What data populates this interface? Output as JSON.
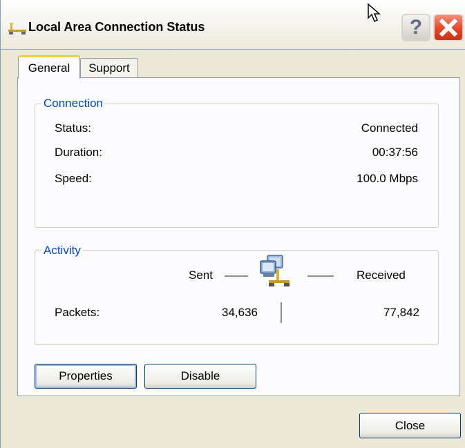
{
  "window": {
    "title": "Local Area Connection Status",
    "help_label": "?",
    "colors": {
      "title_close_red": "#e24727",
      "group_title_blue": "#0046d5",
      "tab_highlight": "#ffc83c"
    }
  },
  "tabs": [
    {
      "label": "General",
      "selected": true
    },
    {
      "label": "Support",
      "selected": false
    }
  ],
  "connection": {
    "title": "Connection",
    "rows": [
      {
        "label": "Status:",
        "value": "Connected"
      },
      {
        "label": "Duration:",
        "value": "00:37:56"
      },
      {
        "label": "Speed:",
        "value": "100.0 Mbps"
      }
    ]
  },
  "activity": {
    "title": "Activity",
    "sent_label": "Sent",
    "received_label": "Received",
    "packets_label": "Packets:",
    "packets_sent": "34,636",
    "packets_received": "77,842",
    "icon": "network-computers-icon"
  },
  "buttons": {
    "properties": "Properties",
    "disable": "Disable",
    "close": "Close"
  }
}
